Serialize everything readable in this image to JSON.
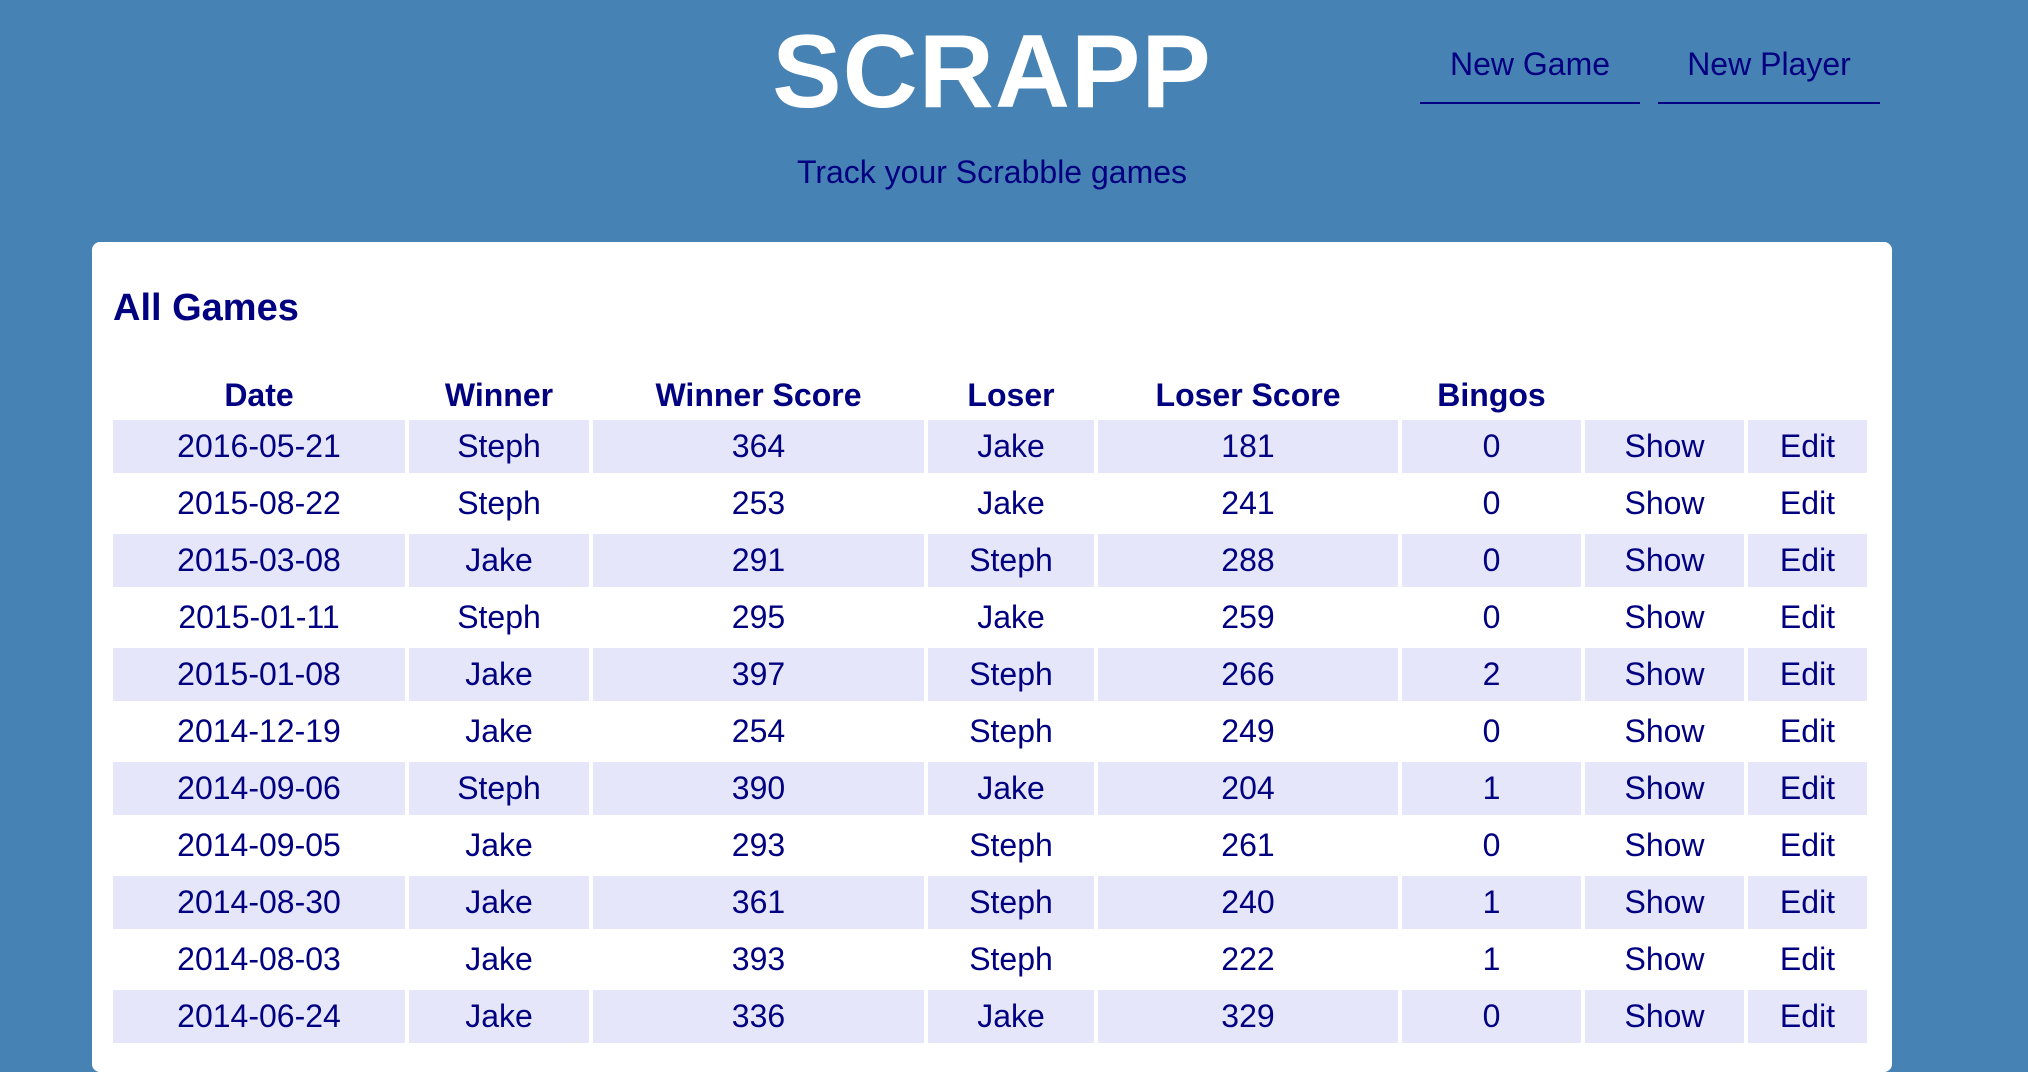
{
  "header": {
    "title": "SCRAPP",
    "tagline": "Track your Scrabble games",
    "nav": {
      "new_game": "New Game",
      "new_player": "New Player"
    }
  },
  "games": {
    "heading": "All Games",
    "columns": [
      "Date",
      "Winner",
      "Winner Score",
      "Loser",
      "Loser Score",
      "Bingos",
      "",
      ""
    ],
    "show_label": "Show",
    "edit_label": "Edit",
    "rows": [
      {
        "date": "2016-05-21",
        "winner": "Steph",
        "winner_score": "364",
        "loser": "Jake",
        "loser_score": "181",
        "bingos": "0"
      },
      {
        "date": "2015-08-22",
        "winner": "Steph",
        "winner_score": "253",
        "loser": "Jake",
        "loser_score": "241",
        "bingos": "0"
      },
      {
        "date": "2015-03-08",
        "winner": "Jake",
        "winner_score": "291",
        "loser": "Steph",
        "loser_score": "288",
        "bingos": "0"
      },
      {
        "date": "2015-01-11",
        "winner": "Steph",
        "winner_score": "295",
        "loser": "Jake",
        "loser_score": "259",
        "bingos": "0"
      },
      {
        "date": "2015-01-08",
        "winner": "Jake",
        "winner_score": "397",
        "loser": "Steph",
        "loser_score": "266",
        "bingos": "2"
      },
      {
        "date": "2014-12-19",
        "winner": "Jake",
        "winner_score": "254",
        "loser": "Steph",
        "loser_score": "249",
        "bingos": "0"
      },
      {
        "date": "2014-09-06",
        "winner": "Steph",
        "winner_score": "390",
        "loser": "Jake",
        "loser_score": "204",
        "bingos": "1"
      },
      {
        "date": "2014-09-05",
        "winner": "Jake",
        "winner_score": "293",
        "loser": "Steph",
        "loser_score": "261",
        "bingos": "0"
      },
      {
        "date": "2014-08-30",
        "winner": "Jake",
        "winner_score": "361",
        "loser": "Steph",
        "loser_score": "240",
        "bingos": "1"
      },
      {
        "date": "2014-08-03",
        "winner": "Jake",
        "winner_score": "393",
        "loser": "Steph",
        "loser_score": "222",
        "bingos": "1"
      },
      {
        "date": "2014-06-24",
        "winner": "Jake",
        "winner_score": "336",
        "loser": "Jake",
        "loser_score": "329",
        "bingos": "0"
      }
    ]
  },
  "colors": {
    "page_background": "#4682b4",
    "text": "#000080",
    "stripe": "#e6e6fa",
    "panel": "#ffffff"
  }
}
